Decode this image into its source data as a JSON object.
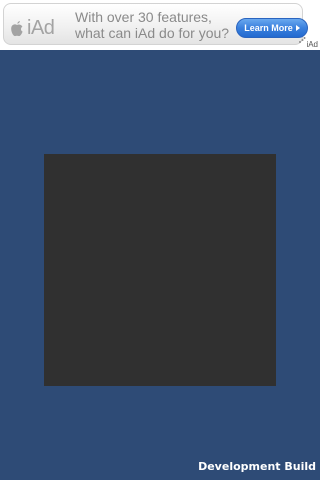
{
  "ad_banner": {
    "brand": "iAd",
    "headline_line1": "With over 30 features,",
    "headline_line2": "what can iAd do for you?",
    "cta_label": "Learn More",
    "tag": "iAd",
    "icons": [
      "apple-logo-icon",
      "chevron-right-icon",
      "dots-icon"
    ]
  },
  "game_view": {
    "status_label": "Development Build"
  },
  "colors": {
    "background": "#2e4b76",
    "square": "#303030",
    "cta": "#3a80dd"
  }
}
